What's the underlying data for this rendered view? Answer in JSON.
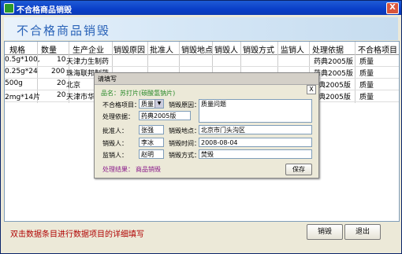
{
  "window": {
    "title": "不合格商品销毁",
    "close_glyph": "X"
  },
  "header": {
    "title": "不合格商品销毁"
  },
  "grid": {
    "columns": [
      "规格",
      "数量",
      "生产企业",
      "销毁原因",
      "批准人",
      "销毁地点",
      "销毁人",
      "销毁方式",
      "监销人",
      "处理依据",
      "不合格项目"
    ],
    "rows": [
      [
        "0.5g*100,",
        "10",
        "天津力生制药",
        "",
        "",
        "",
        "",
        "",
        "",
        "药典2005版",
        "质量"
      ],
      [
        "0.25g*24",
        "200",
        "珠海联邦制药",
        "",
        "",
        "",
        "",
        "",
        "",
        "药典2005版",
        "质量"
      ],
      [
        "500g",
        "20",
        "北京",
        "",
        "",
        "",
        "",
        "",
        "",
        "典2005版",
        "质量"
      ],
      [
        "2mg*14片",
        "20",
        "天津市华",
        "",
        "",
        "",
        "",
        "",
        "",
        "典2005版",
        "质量"
      ]
    ]
  },
  "popup": {
    "tab_label": "请填写",
    "close_glyph": "X",
    "item_name": "品名：苏打片(碳酸氢钠片)",
    "unqualified_label": "不合格项目：",
    "unqualified_value": "质量",
    "reason_label": "销毁原因：",
    "reason_value": "质量问题",
    "basis_label": "处理依据：",
    "basis_value": "药典2005版",
    "approver_label": "批准人：",
    "approver_value": "张强",
    "place_label": "销毁地点：",
    "place_value": "北京市门头沟区",
    "destroyer_label": "销毁人：",
    "destroyer_value": "李冰",
    "time_label": "销毁时间：",
    "time_value": "2008-08-04",
    "supervisor_label": "监销人：",
    "supervisor_value": "赵明",
    "method_label": "销毁方式：",
    "method_value": "焚毁",
    "result_label": "处理结果：",
    "result_value": "商品销毁",
    "save_label": "保存"
  },
  "status": {
    "hint": "双击数据条目进行数据项目的详细填写",
    "destroy_label": "销毁",
    "exit_label": "退出"
  }
}
